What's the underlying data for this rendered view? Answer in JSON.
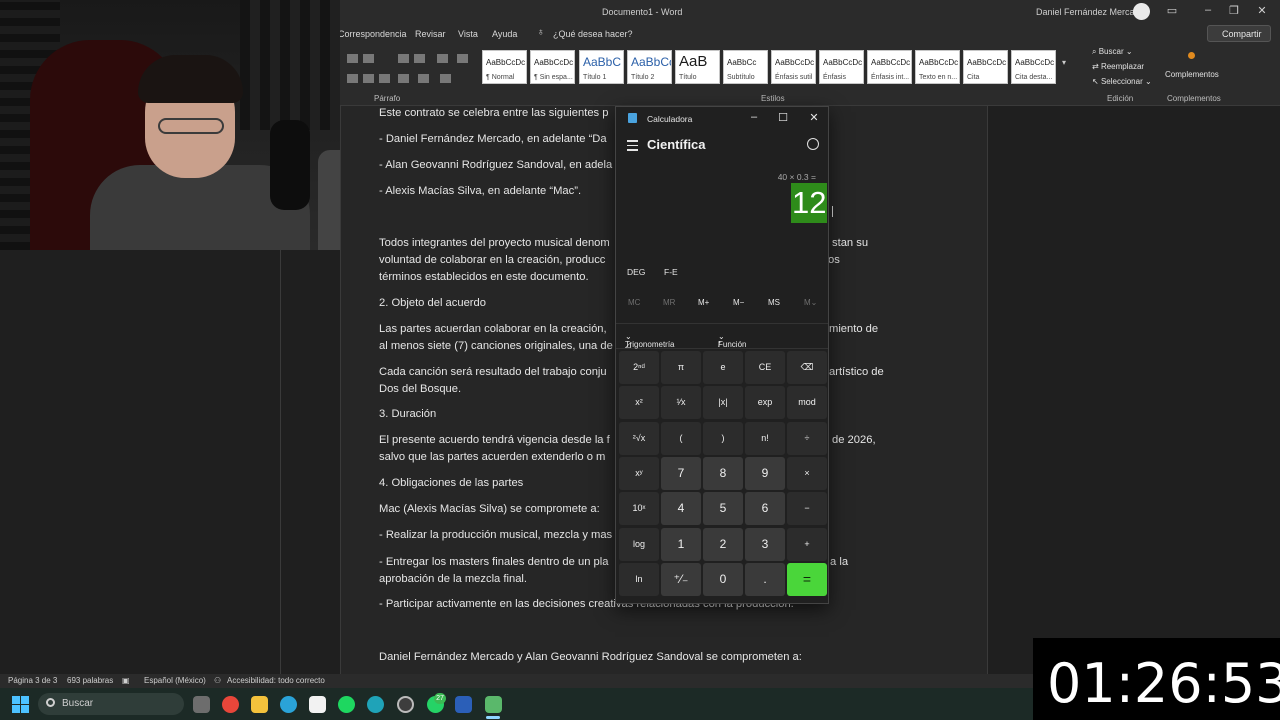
{
  "word": {
    "document_title": "Documento1  -  Word",
    "user_name": "Daniel Fernández Mercado",
    "window_controls": [
      "▭",
      "–",
      "❐",
      "✕"
    ],
    "tabs": [
      "Correspondencia",
      "Revisar",
      "Vista",
      "Ayuda"
    ],
    "tell_me": "¿Qué desea hacer?",
    "share_label": "Compartir",
    "groups": {
      "paragraph": "Párrafo",
      "styles": "Estilos",
      "editing": "Edición",
      "addins": "Complementos"
    },
    "styles": [
      {
        "sample": "AaBbCcDc",
        "name": "¶ Normal"
      },
      {
        "sample": "AaBbCcDc",
        "name": "¶ Sin espa..."
      },
      {
        "sample": "AaBbC",
        "name": "Título 1"
      },
      {
        "sample": "AaBbCc",
        "name": "Título 2"
      },
      {
        "sample": "AaB",
        "name": "Título"
      },
      {
        "sample": "AaBbCc",
        "name": "Subtítulo"
      },
      {
        "sample": "AaBbCcDc",
        "name": "Énfasis sutil"
      },
      {
        "sample": "AaBbCcDc",
        "name": "Énfasis"
      },
      {
        "sample": "AaBbCcDc",
        "name": "Énfasis int..."
      },
      {
        "sample": "AaBbCcDc",
        "name": "Texto en n..."
      },
      {
        "sample": "AaBbCcDc",
        "name": "Cita"
      },
      {
        "sample": "AaBbCcDc",
        "name": "Cita desta..."
      }
    ],
    "editing": {
      "find": "Buscar",
      "replace": "Reemplazar",
      "select": "Seleccionar"
    },
    "addins_label": "Complementos",
    "document_lines": [
      "Este contrato se celebra entre las siguientes p",
      "- Daniel Fernández Mercado, en adelante “Da",
      "- Alan Geovanni Rodríguez Sandoval, en adela",
      "- Alexis Macías Silva, en adelante “Mac”.",
      "Todos integrantes del proyecto musical denom",
      "voluntad de colaborar en la creación, producc",
      "términos establecidos en este documento.",
      "2. Objeto del acuerdo",
      "Las partes acuerdan colaborar en la creación,",
      "al menos siete (7) canciones originales, una de",
      "Cada canción será resultado del trabajo conju",
      "Dos del Bosque.",
      "3. Duración",
      "El presente acuerdo tendrá vigencia desde la f",
      "salvo que las partes acuerden extenderlo o m",
      "4. Obligaciones de las partes",
      "Mac (Alexis Macías Silva) se compromete a:",
      "- Realizar la producción musical, mezcla y mas",
      "- Entregar los masters finales dentro de un pla",
      "aprobación de la mezcla final.",
      "- Participar activamente en las decisiones creativas relacionadas con la producción.",
      "Daniel Fernández Mercado y Alan Geovanni Rodríguez Sandoval se comprometen a:"
    ],
    "document_right_fragments": [
      "stan su",
      "os",
      "miento de",
      "artístico de",
      "de 2026,",
      "a la"
    ],
    "status": {
      "page": "Página 3 de 3",
      "words": "693 palabras",
      "language": "Español (México)",
      "accessibility": "Accesibilidad: todo correcto"
    }
  },
  "calculator": {
    "title": "Calculadora",
    "mode": "Científica",
    "expression": "40 × 0.3 =",
    "result": "12",
    "angle_mode": "DEG",
    "fe_label": "F-E",
    "memory": [
      "MC",
      "MR",
      "M+",
      "M−",
      "MS",
      "M⌄"
    ],
    "trig_label": "Trigonometría",
    "func_label": "Función",
    "keys": [
      [
        "2ⁿᵈ",
        "π",
        "e",
        "CE",
        "⌫"
      ],
      [
        "x²",
        "¹⁄x",
        "|x|",
        "exp",
        "mod"
      ],
      [
        "²√x",
        "(",
        ")",
        "n!",
        "÷"
      ],
      [
        "xʸ",
        "7",
        "8",
        "9",
        "×"
      ],
      [
        "10ˣ",
        "4",
        "5",
        "6",
        "−"
      ],
      [
        "log",
        "1",
        "2",
        "3",
        "+"
      ],
      [
        "ln",
        "⁺⁄₋",
        "0",
        ".",
        "="
      ]
    ]
  },
  "taskbar": {
    "search_placeholder": "Buscar",
    "badge_count": "27",
    "icons": [
      "task-view-icon",
      "chrome-icon",
      "file-explorer-icon",
      "telegram-icon",
      "capcut-icon",
      "spotify-icon",
      "edge-icon",
      "obs-icon",
      "whatsapp-icon",
      "word-icon",
      "calculator-icon"
    ]
  },
  "timer": "01:26:53",
  "colors": {
    "result_highlight": "#2e8b1a",
    "equals_key": "#4ad63a",
    "start_blue": "#4cc2ff",
    "taskbar": "#1c2a26"
  }
}
